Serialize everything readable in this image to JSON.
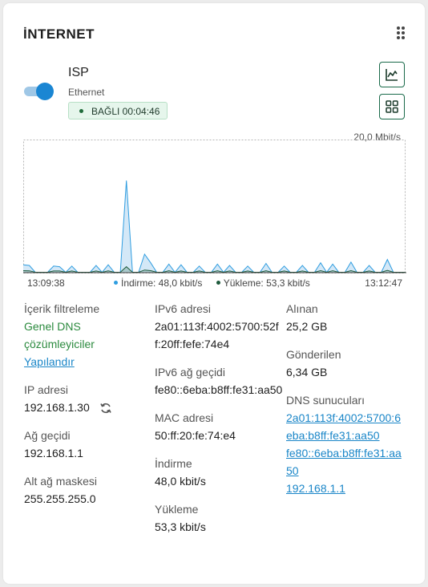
{
  "card": {
    "title": "İNTERNET"
  },
  "connection": {
    "name": "ISP",
    "type": "Ethernet",
    "status": "BAĞLI 00:04:46",
    "enabled": true
  },
  "chart_data": {
    "type": "area",
    "ymax_label": "20,0 Mbit/s",
    "ylim": [
      0,
      20000
    ],
    "x_start": "13:09:38",
    "x_end": "13:12:47",
    "series": [
      {
        "name": "İndirme: 48,0 kbit/s",
        "color": "#2f9de0",
        "values": [
          1200,
          1100,
          50,
          50,
          50,
          1000,
          900,
          50,
          1000,
          50,
          50,
          50,
          1100,
          50,
          1200,
          50,
          50,
          14000,
          50,
          50,
          2800,
          1500,
          50,
          50,
          1300,
          50,
          1200,
          50,
          50,
          1000,
          50,
          50,
          1300,
          50,
          1100,
          50,
          50,
          1000,
          50,
          50,
          1400,
          50,
          50,
          1000,
          50,
          50,
          1100,
          50,
          50,
          1500,
          50,
          1300,
          50,
          50,
          1600,
          50,
          50,
          1100,
          50,
          50,
          2000,
          50,
          50,
          50
        ]
      },
      {
        "name": "Yükleme: 53,3 kbit/s",
        "color": "#1e5a3c",
        "values": [
          300,
          280,
          60,
          60,
          60,
          250,
          260,
          60,
          250,
          60,
          60,
          60,
          260,
          60,
          270,
          60,
          60,
          900,
          60,
          60,
          400,
          300,
          60,
          60,
          280,
          60,
          260,
          60,
          60,
          250,
          60,
          60,
          280,
          60,
          260,
          60,
          60,
          250,
          60,
          60,
          290,
          60,
          60,
          250,
          60,
          60,
          260,
          60,
          60,
          300,
          60,
          280,
          60,
          60,
          310,
          60,
          60,
          260,
          60,
          60,
          350,
          60,
          60,
          60
        ]
      }
    ]
  },
  "details": {
    "content_filter_label": "İçerik filtreleme",
    "content_filter_value": "Genel DNS çözümleyiciler",
    "content_filter_link": "Yapılandır",
    "ip_label": "IP adresi",
    "ip_value": "192.168.1.30",
    "gateway_label": "Ağ geçidi",
    "gateway_value": "192.168.1.1",
    "netmask_label": "Alt ağ maskesi",
    "netmask_value": "255.255.255.0",
    "ipv6_label": "IPv6 adresi",
    "ipv6_value": "2a01:113f:4002:5700:52ff:20ff:fefe:74e4",
    "ipv6_gateway_label": "IPv6 ağ geçidi",
    "ipv6_gateway_value": "fe80::6eba:b8ff:fe31:aa50",
    "mac_label": "MAC adresi",
    "mac_value": "50:ff:20:fe:74:e4",
    "download_label": "İndirme",
    "download_value": "48,0 kbit/s",
    "upload_label": "Yükleme",
    "upload_value": "53,3 kbit/s",
    "received_label": "Alınan",
    "received_value": "25,2 GB",
    "sent_label": "Gönderilen",
    "sent_value": "6,34 GB",
    "dns_label": "DNS sunucuları",
    "dns_servers": [
      "2a01:113f:4002:5700:6eba:b8ff:fe31:aa50",
      "fe80::6eba:b8ff:fe31:aa50",
      "192.168.1.1"
    ]
  },
  "icons": {
    "chart_button": "line-chart-icon",
    "grid_button": "grid-icon",
    "menu": "kebab-menu-icon",
    "refresh": "refresh-icon"
  }
}
